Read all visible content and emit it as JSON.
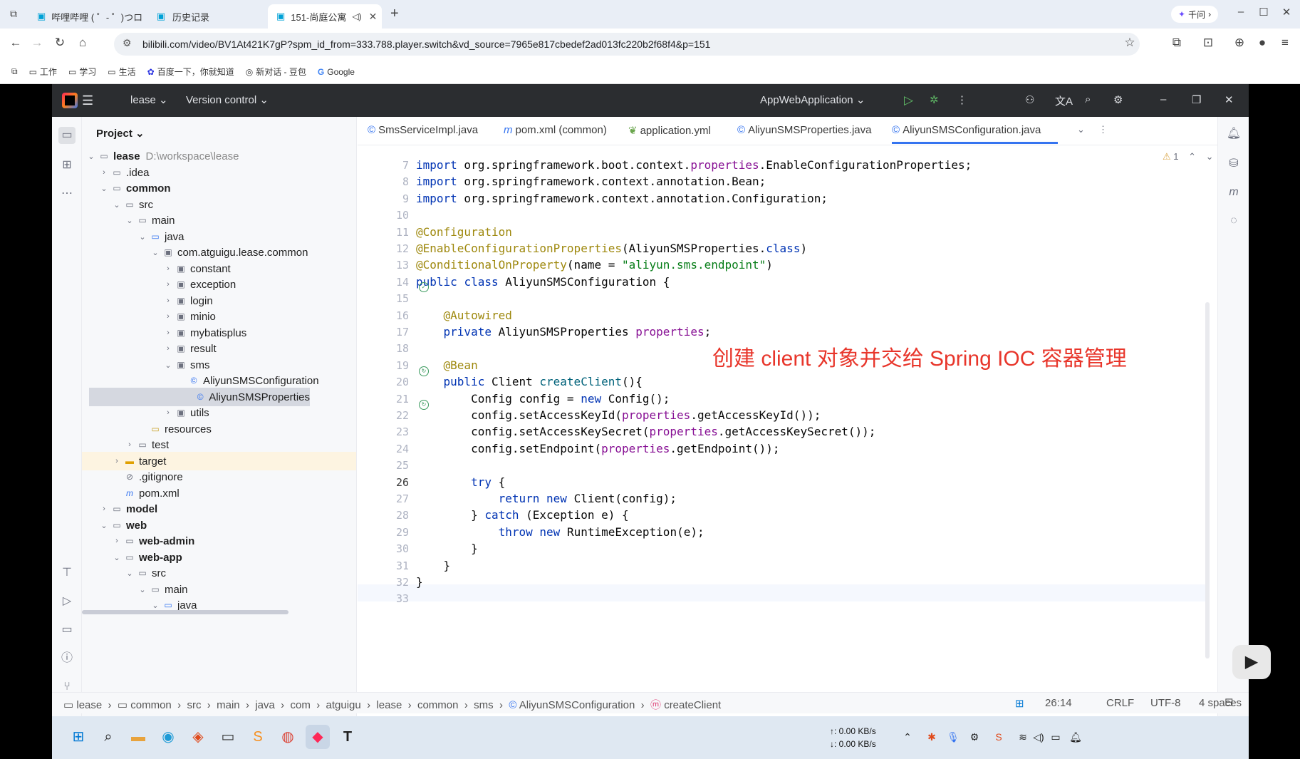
{
  "browser": {
    "tabs": [
      {
        "label": "哔哩哔哩 ( ゜- ゜)つロ",
        "active": false
      },
      {
        "label": "历史记录",
        "active": false
      },
      {
        "label": "151-尚庭公寓",
        "active": true
      }
    ],
    "ai_button": "千问",
    "url": "bilibili.com/video/BV1At421K7gP?spm_id_from=333.788.player.switch&vd_source=7965e817cbedef2ad013fc220b2f68f4&p=151",
    "bookmarks": [
      "工作",
      "学习",
      "生活",
      "百度一下，你就知道",
      "新对话 - 豆包",
      "Google"
    ]
  },
  "ide": {
    "project_name": "lease",
    "version_control": "Version control",
    "run_config": "AppWebApplication",
    "panel_title": "Project",
    "tree": [
      {
        "label": "lease",
        "extra": "D:\\workspace\\lease",
        "bold": true
      },
      {
        "label": ".idea"
      },
      {
        "label": "common",
        "bold": true
      },
      {
        "label": "src"
      },
      {
        "label": "main"
      },
      {
        "label": "java"
      },
      {
        "label": "com.atguigu.lease.common"
      },
      {
        "label": "constant"
      },
      {
        "label": "exception"
      },
      {
        "label": "login"
      },
      {
        "label": "minio"
      },
      {
        "label": "mybatisplus"
      },
      {
        "label": "result"
      },
      {
        "label": "sms"
      },
      {
        "label": "AliyunSMSConfiguration"
      },
      {
        "label": "AliyunSMSProperties"
      },
      {
        "label": "utils"
      },
      {
        "label": "resources"
      },
      {
        "label": "test"
      },
      {
        "label": "target"
      },
      {
        "label": ".gitignore"
      },
      {
        "label": "pom.xml"
      },
      {
        "label": "model",
        "bold": true
      },
      {
        "label": "web",
        "bold": true
      },
      {
        "label": "web-admin",
        "bold": true
      },
      {
        "label": "web-app",
        "bold": true
      },
      {
        "label": "src"
      },
      {
        "label": "main"
      },
      {
        "label": "java"
      }
    ],
    "editor_tabs": [
      "SmsServiceImpl.java",
      "pom.xml (common)",
      "application.yml",
      "AliyunSMSProperties.java",
      "AliyunSMSConfiguration.java"
    ],
    "inspection_count": "1",
    "line_numbers": [
      "7",
      "8",
      "9",
      "10",
      "11",
      "12",
      "13",
      "14",
      "15",
      "16",
      "17",
      "18",
      "19",
      "20",
      "21",
      "22",
      "23",
      "24",
      "25",
      "26",
      "27",
      "28",
      "29",
      "30",
      "31",
      "32",
      "33"
    ],
    "code_lines": [
      "import org.springframework.boot.context.properties.EnableConfigurationProperties;",
      "import org.springframework.context.annotation.Bean;",
      "import org.springframework.context.annotation.Configuration;",
      "",
      "@Configuration",
      "@EnableConfigurationProperties(AliyunSMSProperties.class)",
      "@ConditionalOnProperty(name = \"aliyun.sms.endpoint\")",
      "public class AliyunSMSConfiguration {",
      "",
      "    @Autowired",
      "    private AliyunSMSProperties properties;",
      "",
      "    @Bean",
      "    public Client createClient(){",
      "        Config config = new Config();",
      "        config.setAccessKeyId(properties.getAccessKeyId());",
      "        config.setAccessKeySecret(properties.getAccessKeySecret());",
      "        config.setEndpoint(properties.getEndpoint());",
      "",
      "        try {",
      "            return new Client(config);",
      "        } catch (Exception e) {",
      "            throw new RuntimeException(e);",
      "        }",
      "    }",
      "}",
      ""
    ],
    "annotation_text": "创建 client 对象并交给 Spring IOC 容器管理",
    "breadcrumb": [
      "lease",
      "common",
      "src",
      "main",
      "java",
      "com",
      "atguigu",
      "lease",
      "common",
      "sms",
      "AliyunSMSConfiguration",
      "createClient"
    ],
    "status": {
      "position": "26:14",
      "line_ending": "CRLF",
      "encoding": "UTF-8",
      "indent": "4 spaces"
    }
  },
  "taskbar": {
    "net_up": "↑: 0.00 KB/s",
    "net_down": "↓: 0.00 KB/s"
  },
  "colors": {
    "keyword": "#0033b3",
    "annotation": "#9e880d",
    "string": "#067d17",
    "field": "#871094",
    "method": "#00627a",
    "overlay_text": "#e8362b",
    "accent": "#3574f0"
  }
}
